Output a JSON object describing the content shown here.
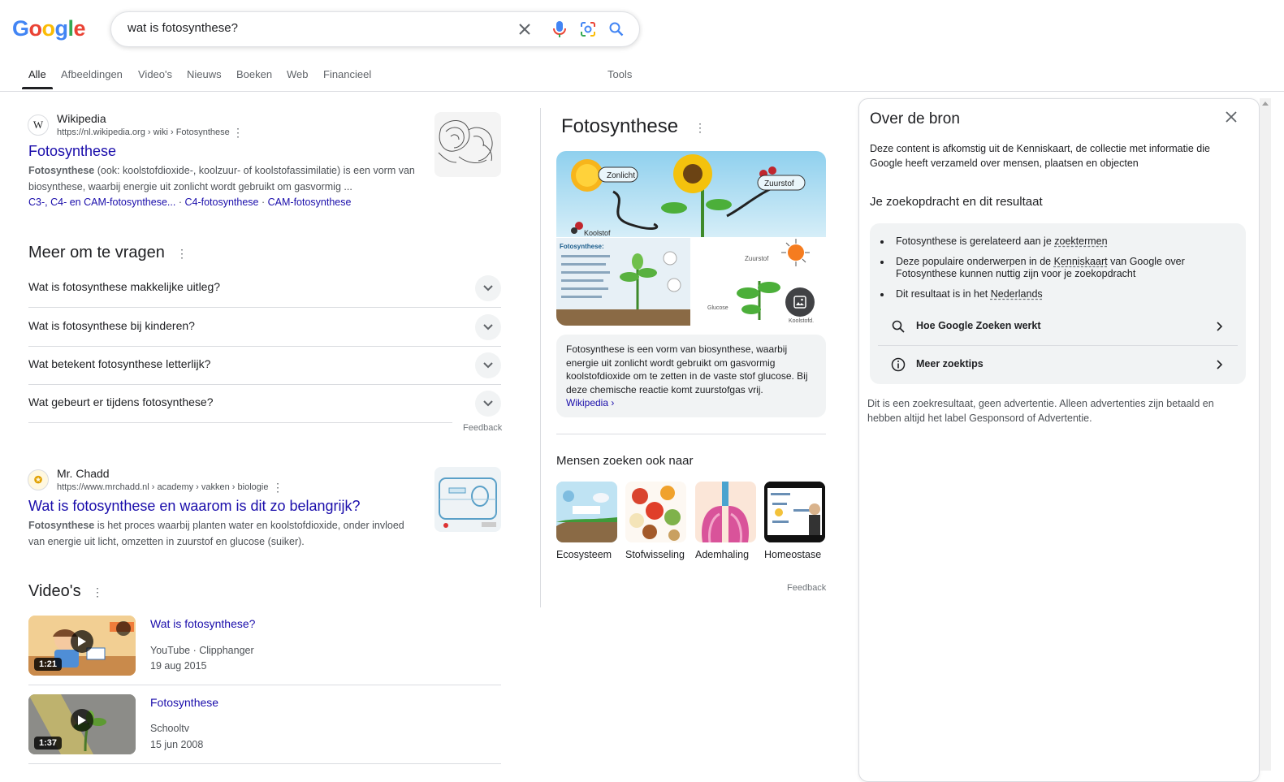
{
  "header": {
    "logo": [
      "G",
      "o",
      "o",
      "g",
      "l",
      "e"
    ],
    "search_query": "wat is fotosynthese?"
  },
  "tabs": [
    {
      "label": "Alle",
      "active": true
    },
    {
      "label": "Afbeeldingen"
    },
    {
      "label": "Video's"
    },
    {
      "label": "Nieuws"
    },
    {
      "label": "Boeken"
    },
    {
      "label": "Web"
    },
    {
      "label": "Financieel"
    }
  ],
  "tools_label": "Tools",
  "result1": {
    "site": "Wikipedia",
    "url": "https://nl.wikipedia.org › wiki › Fotosynthese",
    "title": "Fotosynthese",
    "snippet_bold": "Fotosynthese",
    "snippet": " (ook: koolstofdioxide-, koolzuur- of koolstofassimilatie) is een vorm van biosynthese, waarbij energie uit zonlicht wordt gebruikt om gasvormig ...",
    "sublinks": [
      "C3-, C4- en CAM-fotosynthese...",
      "C4-fotosynthese",
      "CAM-fotosynthese"
    ],
    "sep": "·"
  },
  "paa": {
    "heading": "Meer om te vragen",
    "questions": [
      "Wat is fotosynthese makkelijke uitleg?",
      "Wat is fotosynthese bij kinderen?",
      "Wat betekent fotosynthese letterlijk?",
      "Wat gebeurt er tijdens fotosynthese?"
    ],
    "feedback": "Feedback"
  },
  "result2": {
    "site": "Mr. Chadd",
    "url": "https://www.mrchadd.nl › academy › vakken › biologie",
    "title": "Wat is fotosynthese en waarom is dit zo belangrijk?",
    "snippet_bold": "Fotosynthese",
    "snippet": " is het proces waarbij planten water en koolstofdioxide, onder invloed van energie uit licht, omzetten in zuurstof en glucose (suiker)."
  },
  "videos": {
    "heading": "Video's",
    "items": [
      {
        "title": "Wat is fotosynthese?",
        "source": "YouTube · Clipphanger",
        "date": "19 aug 2015",
        "duration": "1:21"
      },
      {
        "title": "Fotosynthese",
        "source": "Schooltv",
        "date": "15 jun 2008",
        "duration": "1:37"
      }
    ]
  },
  "knowledge_panel": {
    "title": "Fotosynthese",
    "image_labels": {
      "sun": "Zonlicht",
      "oxygen": "Zuurstof",
      "carbon": "Koolstof",
      "chart_title": "Fotosynthese:",
      "sketch": "Zuurstof",
      "glucose": "Glucose",
      "co2": "Koolstofd."
    },
    "description": "Fotosynthese is een vorm van biosynthese, waarbij energie uit zonlicht wordt gebruikt om gasvormig koolstofdioxide om te zetten in de vaste stof glucose. Bij deze chemische reactie komt zuurstofgas vrij.",
    "source_link": "Wikipedia ›",
    "people_also_search": {
      "heading": "Mensen zoeken ook naar",
      "items": [
        "Ecosysteem",
        "Stofwisseling",
        "Ademhaling",
        "Homeostase"
      ]
    },
    "feedback": "Feedback"
  },
  "side_panel": {
    "title": "Over de bron",
    "intro": "Deze content is afkomstig uit de Kenniskaart, de collectie met informatie die Google heeft verzameld over mensen, plaatsen en objecten",
    "subheading": "Je zoekopdracht en dit resultaat",
    "bullets": [
      {
        "pre": "Fotosynthese is gerelateerd aan je ",
        "link": "zoektermen",
        "post": ""
      },
      {
        "pre": "Deze populaire onderwerpen in de ",
        "link": "Kenniskaart",
        "post": " van Google over Fotosynthese kunnen nuttig zijn voor je zoekopdracht"
      },
      {
        "pre": "Dit resultaat is in het ",
        "link": "Nederlands",
        "post": ""
      }
    ],
    "links": [
      "Hoe Google Zoeken werkt",
      "Meer zoektips"
    ],
    "footer": "Dit is een zoekresultaat, geen advertentie. Alleen advertenties zijn betaald en hebben altijd het label Gesponsord of Advertentie."
  }
}
